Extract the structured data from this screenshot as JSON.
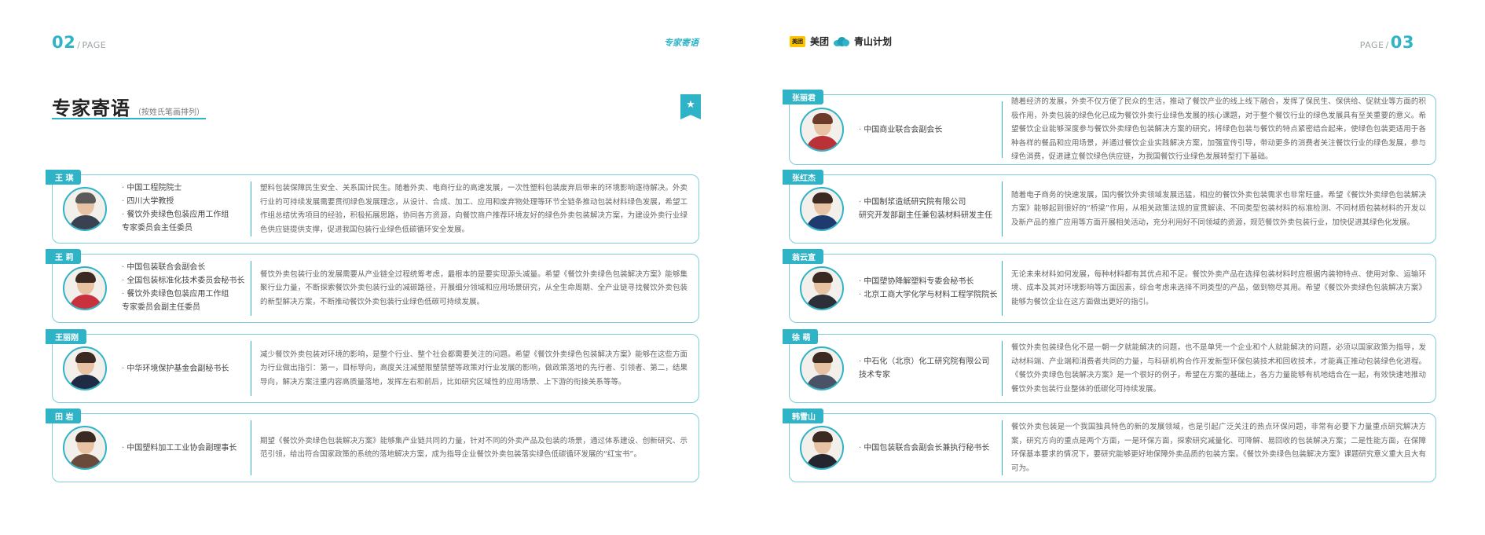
{
  "left_page": {
    "page_number": "02",
    "page_label": "PAGE",
    "running_head": "专家寄语",
    "title": "专家寄语",
    "title_note": "（按姓氏笔画排列）",
    "experts": [
      {
        "name": "王 琪",
        "titles": [
          "中国工程院院士",
          "四川大学教授",
          "餐饮外卖绿色包装应用工作组",
          "专家委员会主任委员"
        ],
        "quote": "塑料包装保障民生安全、关系国计民生。随着外卖、电商行业的高速发展，一次性塑料包装废弃后带来的环境影响逐待解决。外卖行业的可持续发展需要贯彻绿色发展理念，从设计、合成、加工、应用和废弃物处理等环节全链条推动包装材料绿色发展，希望工作组总结优秀项目的经验，积极拓展思路，协同各方资源，向餐饮商户推荐环境友好的绿色外卖包装解决方案，为建设外卖行业绿色供应链提供支撑，促进我国包装行业绿色低碳循环安全发展。"
      },
      {
        "name": "王 莉",
        "titles": [
          "中国包装联合会副会长",
          "全国包装标准化技术委员会秘书长",
          "餐饮外卖绿色包装应用工作组",
          "专家委员会副主任委员"
        ],
        "quote": "餐饮外卖包装行业的发展需要从产业链全过程统筹考虑，最根本的是要实现源头减量。希望《餐饮外卖绿色包装解决方案》能够集聚行业力量，不断探索餐饮外卖包装行业的减碳路径，开展细分领域和应用场景研究，从全生命周期、全产业链寻找餐饮外卖包装的新型解决方案，不断推动餐饮外卖包装行业绿色低碳可持续发展。"
      },
      {
        "name": "王丽刚",
        "titles": [
          "中华环境保护基金会副秘书长"
        ],
        "quote": "减少餐饮外卖包装对环境的影响，是整个行业、整个社会都需要关注的问题。希望《餐饮外卖绿色包装解决方案》能够在这些方面为行业做出指引：第一，目标导向，高度关注减塑限塑禁塑等政策对行业发展的影响，做政策落地的先行者、引领者、第二，结果导向，解决方案注重内容高质量落地，发挥左右和前后，比如研究区域性的应用场景、上下游的衔接关系等等。"
      },
      {
        "name": "田 岩",
        "titles": [
          "中国塑料加工工业协会副理事长"
        ],
        "quote": "期望《餐饮外卖绿色包装解决方案》能够集产业链共同的力量，针对不同的外卖产品及包装的场景，通过体系建设、创新研究、示范引领，给出符合国家政策的系统的落地解决方案，成为指导企业餐饮外卖包装落实绿色低碳循环发展的“红宝书”。"
      }
    ]
  },
  "right_page": {
    "page_number": "03",
    "page_label": "PAGE",
    "brand_meituan": "美团",
    "brand_meituan_logo": "美团",
    "brand_plan": "青山计划",
    "experts": [
      {
        "name": "张丽君",
        "titles": [
          "中国商业联合会副会长"
        ],
        "quote": "随着经济的发展，外卖不仅方便了民众的生活，推动了餐饮产业的线上线下融合，发挥了保民生、保供给、促就业等方面的积极作用，外卖包装的绿色化已成为餐饮外卖行业绿色发展的核心课题，对于整个餐饮行业的绿色发展具有至关重要的意义。希望餐饮企业能够深度参与餐饮外卖绿色包装解决方案的研究，将绿色包装与餐饮的特点紧密结合起来，使绿色包装更适用于各种各样的餐品和应用场景，并通过餐饮企业实践解决方案，加强宣传引导，带动更多的消费者关注餐饮行业的绿色发展，参与绿色消费，促进建立餐饮绿色供应链，为我国餐饮行业绿色发展转型打下基础。"
      },
      {
        "name": "张红杰",
        "titles": [
          "中国制浆造纸研究院有限公司",
          "研究开发部副主任兼包装材料研发主任"
        ],
        "quote": "随着电子商务的快速发展，国内餐饮外卖领域发展迅猛，相应的餐饮外卖包装需求也非常旺盛。希望《餐饮外卖绿色包装解决方案》能够起到很好的“桥梁”作用，从相关政策法规的宣贯解读、不同类型包装材料的标准检测、不同材质包装材料的开发以及新产品的推广应用等方面开展相关活动，充分利用好不同领域的资源，规范餐饮外卖包装行业，加快促进其绿色化发展。"
      },
      {
        "name": "翁云宣",
        "titles": [
          "中国塑协降解塑料专委会秘书长",
          "北京工商大学化学与材料工程学院院长"
        ],
        "quote": "无论未来材料如何发展，每种材料都有其优点和不足。餐饮外卖产品在选择包装材料时应根据内装物特点、使用对象、运输环境、成本及其对环境影响等方面因素，综合考虑来选择不同类型的产品，做到物尽其用。希望《餐饮外卖绿色包装解决方案》能够为餐饮企业在这方面做出更好的指引。"
      },
      {
        "name": "徐 萌",
        "titles": [
          "中石化（北京）化工研究院有限公司",
          "技术专家"
        ],
        "quote": "餐饮外卖包装绿色化不是一朝一夕就能解决的问题，也不是单凭一个企业和个人就能解决的问题，必须以国家政策为指导，发动材料端、产业端和消费者共同的力量，与科研机构合作开发新型环保包装技术和回收技术，才能真正推动包装绿色化进程。《餐饮外卖绿色包装解决方案》是一个很好的例子，希望在方案的基础上，各方力量能够有机地结合在一起，有效快速地推动餐饮外卖包装行业整体的低碳化可持续发展。"
      },
      {
        "name": "韩雪山",
        "titles": [
          "中国包装联合会副会长兼执行秘书长"
        ],
        "quote": "餐饮外卖包装是一个我国独具特色的新的发展领域，也是引起广泛关注的热点环保问题，非常有必要下力量重点研究解决方案，研究方向的重点是两个方面，一是环保方面，探索研究减量化、可降解、易回收的包装解决方案；二是性能方面，在保障环保基本要求的情况下，要研究能够更好地保障外卖品质的包装方案。《餐饮外卖绿色包装解决方案》课题研究意义重大且大有可为。"
      }
    ]
  },
  "colors": {
    "accent": "#2fb3c6",
    "card_border": "#7ccfdb",
    "brand_yellow": "#ffc300"
  },
  "icons": [
    "star-icon",
    "meituan-logo-icon",
    "qingshan-cloud-icon"
  ]
}
